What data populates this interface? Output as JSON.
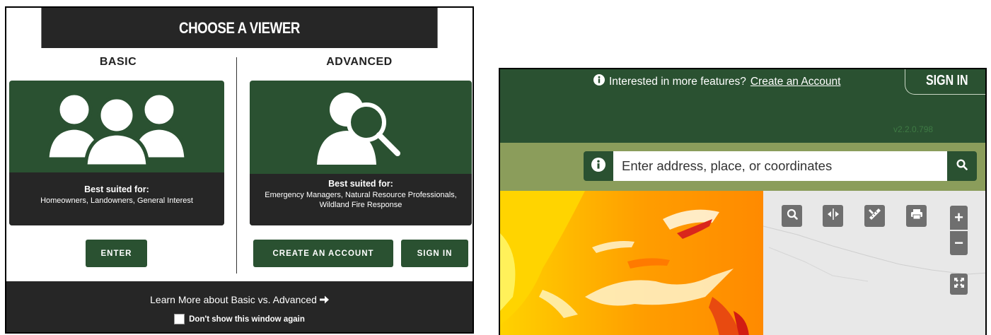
{
  "chooser": {
    "title": "CHOOSE A VIEWER",
    "basic": {
      "heading": "BASIC",
      "best_suited_label": "Best suited for:",
      "best_suited_text": "Homeowners, Landowners, General Interest",
      "icon": "users-group-icon",
      "enter_label": "ENTER"
    },
    "advanced": {
      "heading": "ADVANCED",
      "best_suited_label": "Best suited for:",
      "best_suited_line1": "Emergency Managers, Natural Resource Professionals,",
      "best_suited_line2": "Wildland Fire Response",
      "icon": "user-search-icon",
      "create_label": "CREATE AN ACCOUNT",
      "signin_label": "SIGN IN"
    },
    "footer": {
      "learn_more": "Learn More about Basic vs. Advanced",
      "dont_show": "Don't show this window again"
    }
  },
  "viewer": {
    "info_text": "Interested in more features?",
    "create_account_link": "Create an Account",
    "signin_label": "SIGN IN",
    "version": "v2.2.0.798",
    "search_placeholder": "Enter address, place, or coordinates",
    "tools": [
      "zoom-to-icon",
      "swipe-icon",
      "measure-icon",
      "print-icon"
    ],
    "zoom_in": "+",
    "zoom_out": "−"
  },
  "colors": {
    "dark_green": "#2a5131",
    "olive": "#8b9d5b",
    "dark": "#262626",
    "tool_gray": "#6f6f6f"
  }
}
